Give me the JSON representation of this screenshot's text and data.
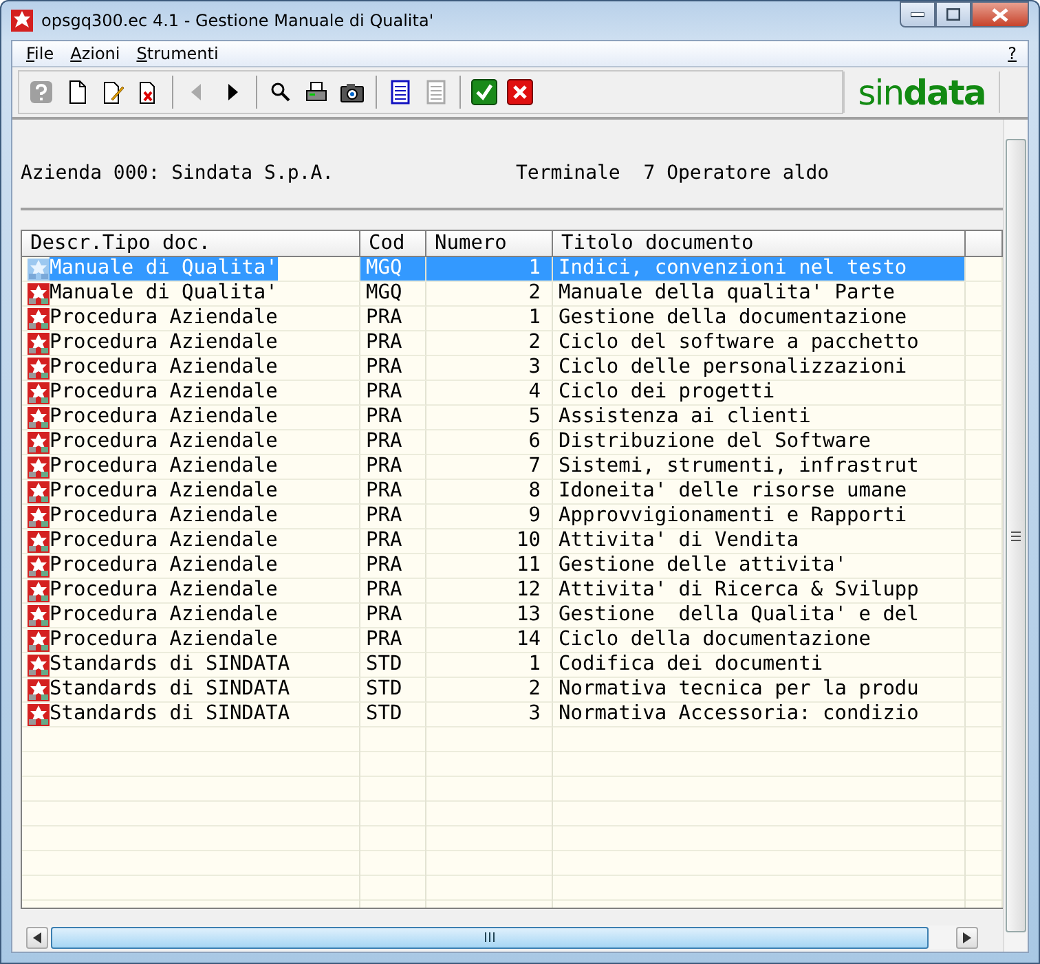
{
  "window": {
    "title": "opsgq300.ec 4.1 - Gestione Manuale di Qualita'"
  },
  "menu": [
    {
      "label": "File"
    },
    {
      "label": "Azioni"
    },
    {
      "label": "Strumenti"
    }
  ],
  "menu_help": "?",
  "toolbar": [
    {
      "kind": "help",
      "disabled": true
    },
    {
      "kind": "new",
      "disabled": false
    },
    {
      "kind": "edit",
      "disabled": false
    },
    {
      "kind": "delete",
      "disabled": false
    },
    {
      "kind": "sep"
    },
    {
      "kind": "prev",
      "disabled": true
    },
    {
      "kind": "next",
      "disabled": false
    },
    {
      "kind": "sep"
    },
    {
      "kind": "search",
      "disabled": false
    },
    {
      "kind": "print",
      "disabled": false
    },
    {
      "kind": "camera",
      "disabled": false
    },
    {
      "kind": "sep"
    },
    {
      "kind": "list",
      "disabled": false
    },
    {
      "kind": "list",
      "disabled": true
    },
    {
      "kind": "sep"
    },
    {
      "kind": "ok",
      "disabled": false
    },
    {
      "kind": "cancel",
      "disabled": false
    }
  ],
  "logo": {
    "light": "sin",
    "bold": "data"
  },
  "header": {
    "company": "Azienda 000: Sindata S.p.A.",
    "terminal": "Terminale  7 Operatore aldo"
  },
  "table": {
    "columns": [
      "Descr.Tipo doc.",
      "Cod",
      "Numero",
      "Titolo documento"
    ],
    "rows": [
      {
        "desc": "Manuale di Qualita'",
        "cod": "MGQ",
        "numero": "1",
        "titolo": "Indici, convenzioni nel testo",
        "selected": true
      },
      {
        "desc": "Manuale di Qualita'",
        "cod": "MGQ",
        "numero": "2",
        "titolo": "Manuale della qualita' Parte",
        "selected": false
      },
      {
        "desc": "Procedura Aziendale",
        "cod": "PRA",
        "numero": "1",
        "titolo": "Gestione della documentazione",
        "selected": false
      },
      {
        "desc": "Procedura Aziendale",
        "cod": "PRA",
        "numero": "2",
        "titolo": "Ciclo del software a pacchetto",
        "selected": false
      },
      {
        "desc": "Procedura Aziendale",
        "cod": "PRA",
        "numero": "3",
        "titolo": "Ciclo delle personalizzazioni",
        "selected": false
      },
      {
        "desc": "Procedura Aziendale",
        "cod": "PRA",
        "numero": "4",
        "titolo": "Ciclo dei progetti",
        "selected": false
      },
      {
        "desc": "Procedura Aziendale",
        "cod": "PRA",
        "numero": "5",
        "titolo": "Assistenza ai clienti",
        "selected": false
      },
      {
        "desc": "Procedura Aziendale",
        "cod": "PRA",
        "numero": "6",
        "titolo": "Distribuzione del Software",
        "selected": false
      },
      {
        "desc": "Procedura Aziendale",
        "cod": "PRA",
        "numero": "7",
        "titolo": "Sistemi, strumenti, infrastrut",
        "selected": false
      },
      {
        "desc": "Procedura Aziendale",
        "cod": "PRA",
        "numero": "8",
        "titolo": "Idoneita' delle risorse umane",
        "selected": false
      },
      {
        "desc": "Procedura Aziendale",
        "cod": "PRA",
        "numero": "9",
        "titolo": "Approvvigionamenti e Rapporti",
        "selected": false
      },
      {
        "desc": "Procedura Aziendale",
        "cod": "PRA",
        "numero": "10",
        "titolo": "Attivita' di Vendita",
        "selected": false
      },
      {
        "desc": "Procedura Aziendale",
        "cod": "PRA",
        "numero": "11",
        "titolo": "Gestione delle attivita'",
        "selected": false
      },
      {
        "desc": "Procedura Aziendale",
        "cod": "PRA",
        "numero": "12",
        "titolo": "Attivita' di Ricerca & Svilupp",
        "selected": false
      },
      {
        "desc": "Procedura Aziendale",
        "cod": "PRA",
        "numero": "13",
        "titolo": "Gestione  della Qualita' e del",
        "selected": false
      },
      {
        "desc": "Procedura Aziendale",
        "cod": "PRA",
        "numero": "14",
        "titolo": "Ciclo della documentazione",
        "selected": false
      },
      {
        "desc": "Standards di SINDATA",
        "cod": "STD",
        "numero": "1",
        "titolo": "Codifica dei documenti",
        "selected": false
      },
      {
        "desc": "Standards di SINDATA",
        "cod": "STD",
        "numero": "2",
        "titolo": "Normativa tecnica per la produ",
        "selected": false
      },
      {
        "desc": "Standards di SINDATA",
        "cod": "STD",
        "numero": "3",
        "titolo": "Normativa Accessoria: condizio",
        "selected": false
      }
    ]
  }
}
